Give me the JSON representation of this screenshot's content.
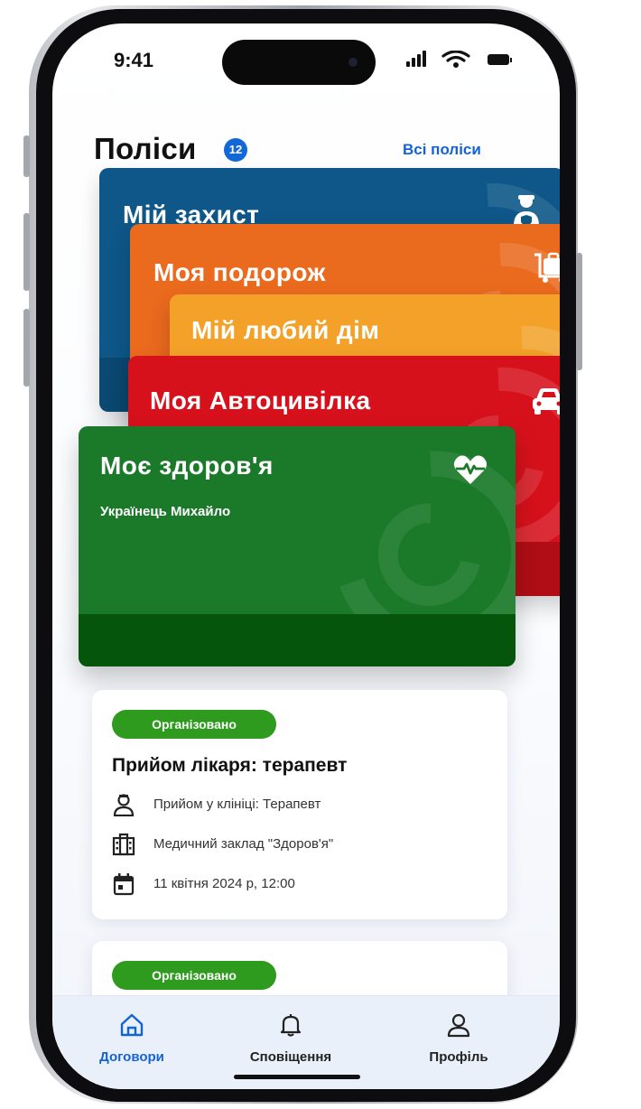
{
  "status_bar": {
    "time": "9:41"
  },
  "header": {
    "title": "Поліси",
    "count": "12",
    "all_link": "Всі поліси"
  },
  "cards": [
    {
      "name": "Мій захист",
      "color": "#0e5788",
      "icon": "person-shield-icon"
    },
    {
      "name": "Моя подорож",
      "color": "#ea6a1e",
      "icon": "luggage-icon"
    },
    {
      "name": "Мій любий дім",
      "color": "#f3a128",
      "icon": "house-building-icon"
    },
    {
      "name": "Моя Автоцивілка",
      "color": "#d6111c",
      "icon": "car-icon"
    },
    {
      "name": "Моє здоров'я",
      "color": "#1b7a2a",
      "icon": "heart-pulse-icon",
      "holder": "Українець Михайло"
    }
  ],
  "appointments": [
    {
      "status": "Організовано",
      "title": "Прийом лікаря: терапевт",
      "type": "Прийом у клініці: Терапевт",
      "facility": "Медичний заклад \"Здоров'я\"",
      "datetime": "11 квітня 2024 р, 12:00"
    },
    {
      "status": "Організовано"
    }
  ],
  "tabbar": {
    "tabs": [
      {
        "label": "Договори",
        "icon": "home-icon",
        "active": true
      },
      {
        "label": "Сповіщення",
        "icon": "bell-icon",
        "active": false
      },
      {
        "label": "Профіль",
        "icon": "person-icon",
        "active": false
      }
    ],
    "active_color": "#1463d6",
    "inactive_color": "#222222"
  }
}
